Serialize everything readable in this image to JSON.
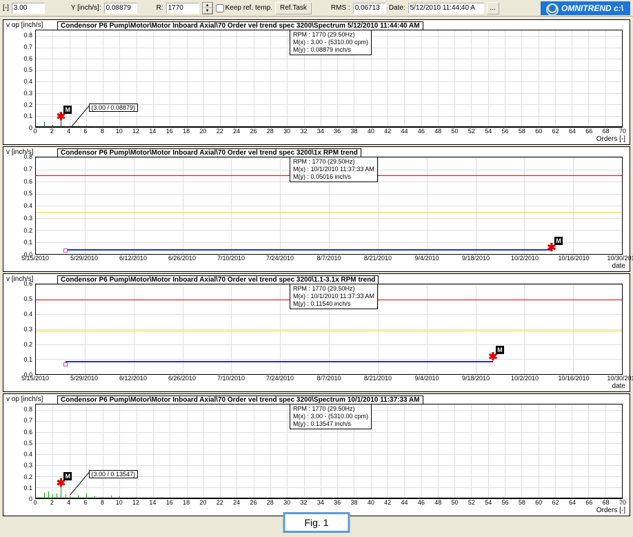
{
  "toolbar": {
    "bracket_label": "[-]",
    "bracket_value": "3.00",
    "y_label": "Y [inch/s]:",
    "y_value": "0.08879",
    "r_label": "R:",
    "r_value": "1770",
    "keep_ref": "Keep ref. temp.",
    "ref_task": "Ref.Task",
    "rms_label": "RMS :",
    "rms_value": "0.06713",
    "date_label": "Date:",
    "date_value": "5/12/2010 11:44:40 A",
    "ellipsis": "..."
  },
  "brand": "OMNITREND c:\\",
  "fig_label": "Fig. 1",
  "chart_data": [
    {
      "type": "line",
      "ylabel": "v op [inch/s]",
      "title": "Condensor P6 Pump\\Motor\\Motor Inboard Axial\\70 Order vel trend spec 3200\\Spectrum 5/12/2010 11:44:40 AM",
      "xlabel": "Orders [-]",
      "legend": [
        "RPM : 1770 (29.50Hz)",
        "M(x) : 3.00 - (5310.00 cpm)",
        "M(y) : 0.08879 inch/s"
      ],
      "callout": "(3.00 / 0.08879)",
      "yticks": [
        "0",
        "0.1",
        "0.2",
        "0.3",
        "0.4",
        "0.5",
        "0.6",
        "0.7",
        "0.8"
      ],
      "xticks": [
        "0",
        "2",
        "4",
        "6",
        "8",
        "10",
        "12",
        "14",
        "16",
        "18",
        "20",
        "22",
        "24",
        "26",
        "28",
        "30",
        "32",
        "34",
        "36",
        "38",
        "40",
        "42",
        "44",
        "46",
        "48",
        "50",
        "52",
        "54",
        "56",
        "58",
        "60",
        "62",
        "64",
        "66",
        "68",
        "70"
      ],
      "ylim": [
        0,
        0.85
      ],
      "xlim": [
        0,
        70
      ],
      "marker": {
        "x": 3.0,
        "y": 0.08879
      },
      "spectrum_peaks": [
        {
          "x": 1.0,
          "y": 0.04
        },
        {
          "x": 2.0,
          "y": 0.02
        },
        {
          "x": 3.0,
          "y": 0.089
        },
        {
          "x": 4.0,
          "y": 0.01
        },
        {
          "x": 5.0,
          "y": 0.015
        },
        {
          "x": 6.0,
          "y": 0.01
        },
        {
          "x": 7.0,
          "y": 0.008
        }
      ]
    },
    {
      "type": "line",
      "ylabel": "v [inch/s]",
      "title": "Condensor P6 Pump\\Motor\\Motor Inboard Axial\\70 Order vel trend spec 3200\\1x RPM trend",
      "xlabel": "date",
      "legend": [
        "RPM : 1770 (29.50Hz)",
        "M(x) : 10/1/2010 11:37:33 AM",
        "M(y) : 0.05016 inch/s"
      ],
      "yticks": [
        "0.0",
        "0.1",
        "0.2",
        "0.3",
        "0.4",
        "0.5",
        "0.6",
        "0.7",
        "0.8"
      ],
      "xticks": [
        "5/15/2010",
        "5/29/2010",
        "6/12/2010",
        "6/26/2010",
        "7/10/2010",
        "7/24/2010",
        "8/7/2010",
        "8/21/2010",
        "9/4/2010",
        "9/18/2010",
        "10/2/2010",
        "10/16/2010",
        "10/30/2010"
      ],
      "ylim": [
        0,
        0.8
      ],
      "alarm": {
        "red": 0.65,
        "yellow": 0.35
      },
      "trend": {
        "y1": 0.03,
        "y2": 0.05,
        "x1_pct": 5,
        "x2_pct": 88
      },
      "marker": {
        "x_pct": 88,
        "y": 0.05
      }
    },
    {
      "type": "line",
      "ylabel": "v [inch/s]",
      "title": "Condensor P6 Pump\\Motor\\Motor Inboard Axial\\70 Order vel trend spec 3200\\1.1-3.1x RPM trend",
      "xlabel": "date",
      "legend": [
        "RPM : 1770 (29.50Hz)",
        "M(x) : 10/1/2010 11:37:33 AM",
        "M(y) : 0.11540 inch/s"
      ],
      "yticks": [
        "0.0",
        "0.1",
        "0.2",
        "0.3",
        "0.4",
        "0.5",
        "0.6"
      ],
      "xticks": [
        "5/15/2010",
        "5/29/2010",
        "6/12/2010",
        "6/26/2010",
        "7/10/2010",
        "7/24/2010",
        "8/7/2010",
        "8/21/2010",
        "9/4/2010",
        "9/18/2010",
        "10/2/2010",
        "10/16/2010",
        "10/30/2010"
      ],
      "ylim": [
        0,
        0.6
      ],
      "alarm": {
        "red": 0.5,
        "yellow": 0.29
      },
      "trend": {
        "y1": 0.065,
        "y2": 0.115,
        "x1_pct": 5,
        "x2_pct": 78
      },
      "marker": {
        "x_pct": 78,
        "y": 0.115
      }
    },
    {
      "type": "line",
      "ylabel": "v op [inch/s]",
      "title": "Condensor P6 Pump\\Motor\\Motor Inboard Axial\\70 Order vel trend spec 3200\\Spectrum 10/1/2010 11:37:33 AM",
      "xlabel": "Orders [-]",
      "legend": [
        "RPM : 1770 (29.50Hz)",
        "M(x) : 3.00 - (5310.00 cpm)",
        "M(y) : 0.13547 inch/s"
      ],
      "callout": "(3.00 / 0.13547)",
      "yticks": [
        "0",
        "0.1",
        "0.2",
        "0.3",
        "0.4",
        "0.5",
        "0.6",
        "0.7",
        "0.8"
      ],
      "xticks": [
        "0",
        "2",
        "4",
        "6",
        "8",
        "10",
        "12",
        "14",
        "16",
        "18",
        "20",
        "22",
        "24",
        "26",
        "28",
        "30",
        "32",
        "34",
        "36",
        "38",
        "40",
        "42",
        "44",
        "46",
        "48",
        "50",
        "52",
        "54",
        "56",
        "58",
        "60",
        "62",
        "64",
        "66",
        "68",
        "70"
      ],
      "ylim": [
        0,
        0.85
      ],
      "xlim": [
        0,
        70
      ],
      "marker": {
        "x": 3.0,
        "y": 0.13547
      },
      "spectrum_peaks": [
        {
          "x": 1.0,
          "y": 0.05
        },
        {
          "x": 1.5,
          "y": 0.06
        },
        {
          "x": 2.0,
          "y": 0.04
        },
        {
          "x": 2.5,
          "y": 0.045
        },
        {
          "x": 3.0,
          "y": 0.135
        },
        {
          "x": 3.5,
          "y": 0.035
        },
        {
          "x": 4.0,
          "y": 0.02
        },
        {
          "x": 5.0,
          "y": 0.025
        },
        {
          "x": 6.0,
          "y": 0.045
        },
        {
          "x": 7.0,
          "y": 0.02
        },
        {
          "x": 8.0,
          "y": 0.015
        },
        {
          "x": 9.0,
          "y": 0.025
        },
        {
          "x": 10.0,
          "y": 0.02
        },
        {
          "x": 12.0,
          "y": 0.015
        },
        {
          "x": 15.0,
          "y": 0.01
        }
      ]
    }
  ]
}
